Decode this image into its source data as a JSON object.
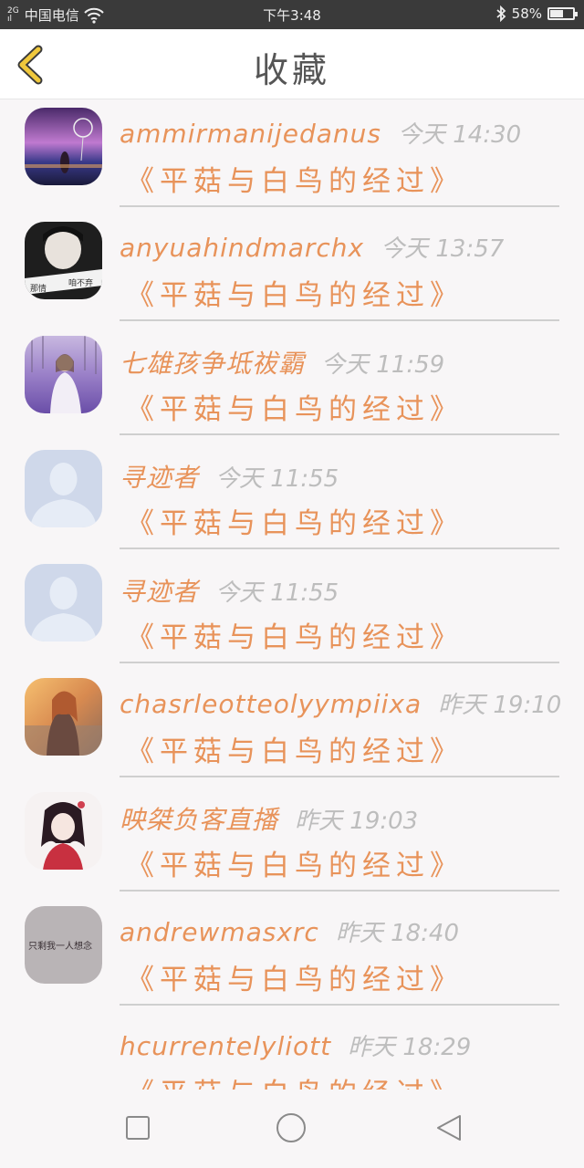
{
  "status_bar": {
    "net_type": "2G",
    "signal_bars": "ıl",
    "carrier": "中国电信",
    "wifi_icon": "wifi-icon",
    "time": "下午3:48",
    "bluetooth_icon": "bluetooth-icon",
    "battery_text": "58%",
    "battery_level_percent": 58
  },
  "header": {
    "title": "收藏",
    "back_icon": "chevron-left-icon",
    "back_color": "#e8c33a"
  },
  "colors": {
    "accent": "#e8935a",
    "time": "#bdbdbd"
  },
  "favorites": [
    {
      "name": "ammirmanijedanus",
      "time": "今天 14:30",
      "book": "《平菇与白鸟的经过》"
    },
    {
      "name": "anyuahindmarchx",
      "time": "今天 13:57",
      "book": "《平菇与白鸟的经过》",
      "avatar_text_left": "那情",
      "avatar_text_right": "咱不弃"
    },
    {
      "name": "七雄孩争坻祓霸",
      "time": "今天 11:59",
      "book": "《平菇与白鸟的经过》"
    },
    {
      "name": "寻迹者",
      "time": "今天 11:55",
      "book": "《平菇与白鸟的经过》"
    },
    {
      "name": "寻迹者",
      "time": "今天 11:55",
      "book": "《平菇与白鸟的经过》"
    },
    {
      "name": "chasrleotteolyympiixa",
      "time": "昨天 19:10",
      "book": "《平菇与白鸟的经过》"
    },
    {
      "name": "映桀负客直播",
      "time": "昨天 19:03",
      "book": "《平菇与白鸟的经过》"
    },
    {
      "name": "andrewmasxrc",
      "time": "昨天 18:40",
      "book": "《平菇与白鸟的经过》",
      "avatar_text": "只剩我一人想念"
    },
    {
      "name": "hcurrentelyliott",
      "time": "昨天 18:29",
      "book": "《平菇与白鸟的经过》"
    }
  ],
  "nav_bar": {
    "recent_icon": "square-icon",
    "home_icon": "circle-icon",
    "back_icon": "triangle-back-icon"
  }
}
